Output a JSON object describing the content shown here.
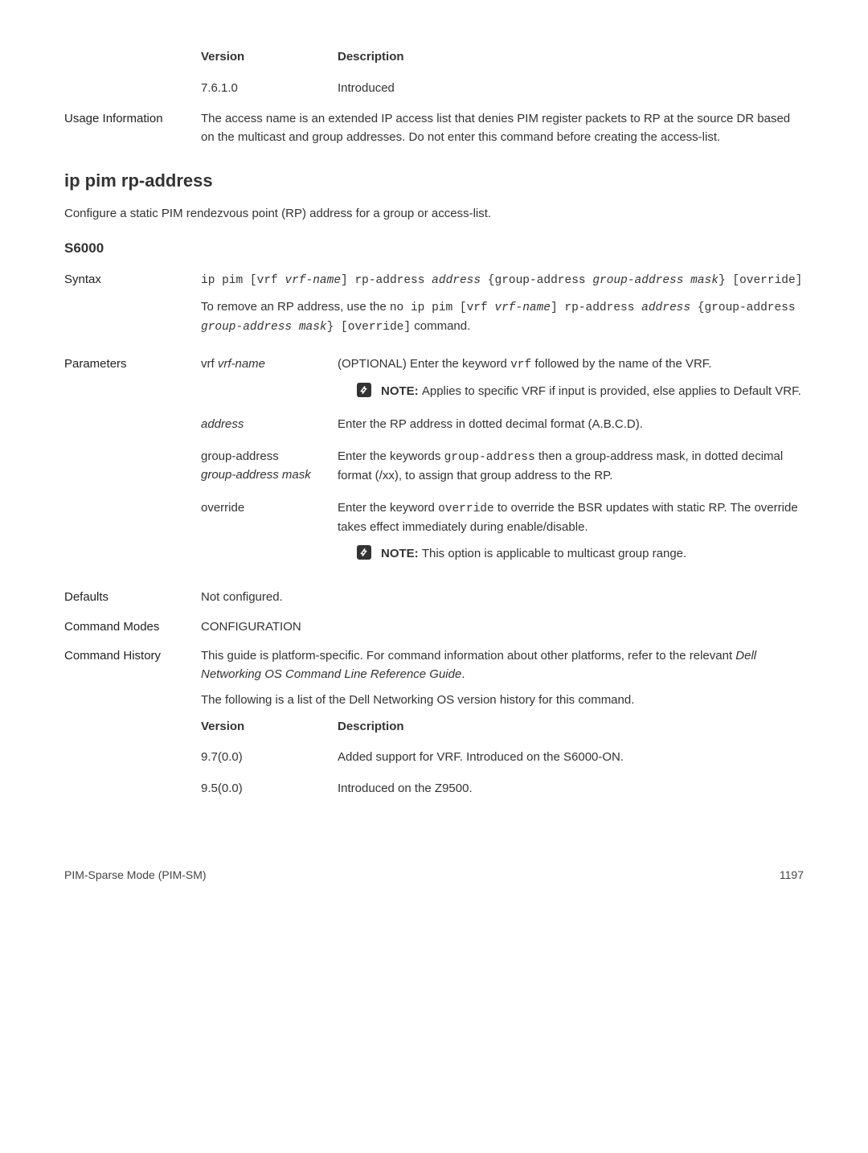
{
  "top_table": {
    "col1": "Version",
    "col2": "Description",
    "row1_v": "7.6.1.0",
    "row1_d": "Introduced"
  },
  "usage": {
    "label": "Usage Information",
    "text": "The access name is an extended IP access list that denies PIM register packets to RP at the source DR based on the multicast and group addresses. Do not enter this command before creating the access-list."
  },
  "section": {
    "title": "ip pim rp-address",
    "subtitle": "Configure a static PIM rendezvous point (RP) address for a group or access-list.",
    "platform": "S6000"
  },
  "syntax": {
    "label": "Syntax",
    "cmd_pre": "ip pim [vrf ",
    "cmd_vrf": "vrf-name",
    "cmd_mid1": "] rp-address ",
    "cmd_addr": "address",
    "cmd_mid2": " {group-address ",
    "cmd_gam": "group-address mask",
    "cmd_end": "} [override]",
    "remove_pre": "To remove an RP address, use the ",
    "remove_cmd1": "no ip pim [vrf ",
    "remove_vrf": "vrf-name",
    "remove_cmd2": "] rp-address ",
    "remove_addr": "address",
    "remove_cmd3": " {group-address ",
    "remove_gam": "group-address mask",
    "remove_cmd4": "} [override]",
    "remove_post": " command."
  },
  "params": {
    "label": "Parameters",
    "vrf": {
      "label_pre": "vrf ",
      "label_ital": "vrf-name",
      "desc_pre": "(OPTIONAL) Enter the keyword ",
      "desc_kw": "vrf",
      "desc_post": " followed by the name of the VRF.",
      "note_label": "NOTE: ",
      "note_text": "Applies to specific VRF if input is provided, else applies to Default VRF."
    },
    "address": {
      "label": "address",
      "desc": "Enter the RP address in dotted decimal format (A.B.C.D)."
    },
    "group": {
      "label1": "group-address ",
      "label2": "group-address mask",
      "desc_pre": "Enter the keywords ",
      "desc_kw": "group-address",
      "desc_post": " then a group-address mask, in dotted decimal format (/xx), to assign that group address to the RP."
    },
    "override": {
      "label": "override",
      "desc_pre": "Enter the keyword ",
      "desc_kw": "override",
      "desc_post": " to override the BSR updates with static RP. The override takes effect immediately during enable/disable.",
      "note_label": "NOTE: ",
      "note_text": "This option is applicable to multicast group range."
    }
  },
  "defaults": {
    "label": "Defaults",
    "value": "Not configured."
  },
  "modes": {
    "label": "Command Modes",
    "value": "CONFIGURATION"
  },
  "history": {
    "label": "Command History",
    "p1_pre": "This guide is platform-specific. For command information about other platforms, refer to the relevant ",
    "p1_ital": "Dell Networking OS Command Line Reference Guide",
    "p1_post": ".",
    "p2": "The following is a list of the Dell Networking OS version history for this command.",
    "col1": "Version",
    "col2": "Description",
    "r1v": "9.7(0.0)",
    "r1d": "Added support for VRF. Introduced on the S6000-ON.",
    "r2v": "9.5(0.0)",
    "r2d": "Introduced on the Z9500."
  },
  "footer": {
    "left": "PIM-Sparse Mode (PIM-SM)",
    "right": "1197"
  }
}
